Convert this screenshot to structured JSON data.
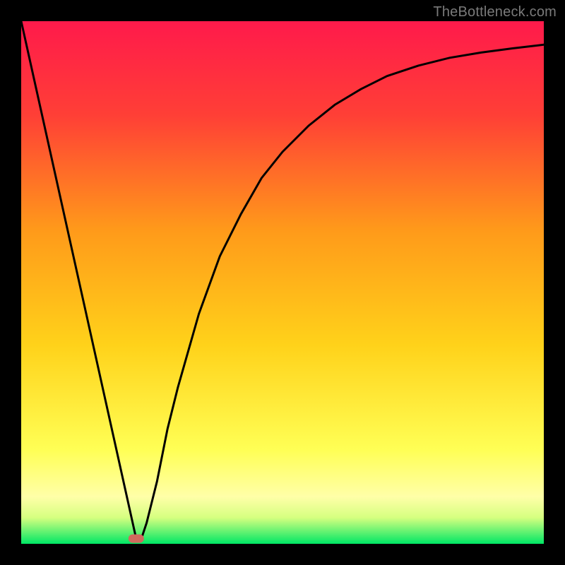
{
  "watermark": "TheBottleneck.com",
  "chart_data": {
    "type": "line",
    "title": "",
    "xlabel": "",
    "ylabel": "",
    "xlim": [
      0,
      100
    ],
    "ylim": [
      0,
      100
    ],
    "background_gradient": {
      "top": "#ff1a4b",
      "mid_upper": "#ff7a2a",
      "mid": "#ffd21a",
      "mid_lower": "#ffff66",
      "bottom": "#00e765"
    },
    "marker": {
      "x": 22,
      "y": 1,
      "color": "#cf6a5d"
    },
    "series": [
      {
        "name": "curve",
        "x": [
          0,
          4,
          8,
          12,
          16,
          20,
          22,
          23,
          24,
          26,
          28,
          30,
          34,
          38,
          42,
          46,
          50,
          55,
          60,
          65,
          70,
          76,
          82,
          88,
          94,
          100
        ],
        "y": [
          100,
          82,
          64,
          46,
          28,
          10,
          1,
          1,
          4,
          12,
          22,
          30,
          44,
          55,
          63,
          70,
          75,
          80,
          84,
          87,
          89.5,
          91.5,
          93,
          94,
          94.8,
          95.5
        ]
      }
    ]
  }
}
